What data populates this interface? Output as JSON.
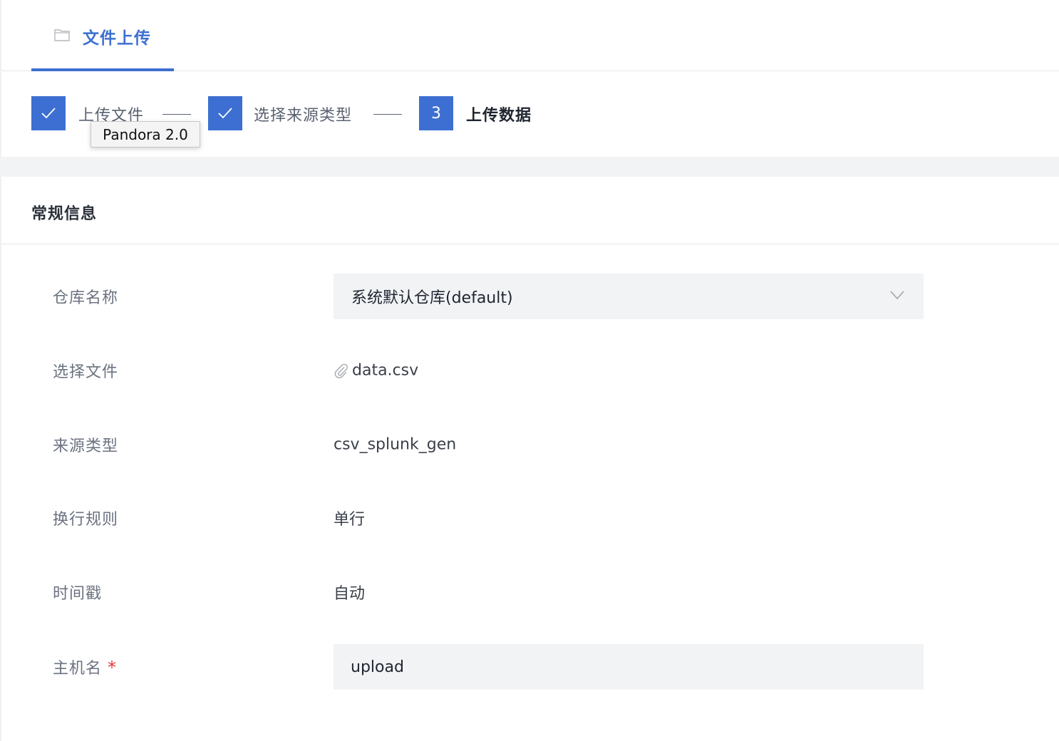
{
  "tab": {
    "label": "文件上传",
    "icon": "folder-icon"
  },
  "steps": [
    {
      "label": "上传文件",
      "state": "done",
      "icon": "check-icon"
    },
    {
      "label": "选择来源类型",
      "state": "done",
      "icon": "check-icon"
    },
    {
      "label": "上传数据",
      "state": "active",
      "number": "3"
    }
  ],
  "tooltip": {
    "text": "Pandora 2.0"
  },
  "section": {
    "title": "常规信息"
  },
  "form": {
    "warehouse": {
      "label": "仓库名称",
      "value": "系统默认仓库(default)",
      "icon": "chevron-down-icon"
    },
    "file": {
      "label": "选择文件",
      "value": "data.csv",
      "icon": "paperclip-icon"
    },
    "source_type": {
      "label": "来源类型",
      "value": "csv_splunk_gen"
    },
    "line_rule": {
      "label": "换行规则",
      "value": "单行"
    },
    "timestamp": {
      "label": "时间戳",
      "value": "自动"
    },
    "hostname": {
      "label": "主机名",
      "required_mark": "*",
      "value": "upload"
    }
  },
  "colors": {
    "accent": "#3c6fd1",
    "required": "#e53935",
    "field_bg": "#f2f3f5"
  }
}
